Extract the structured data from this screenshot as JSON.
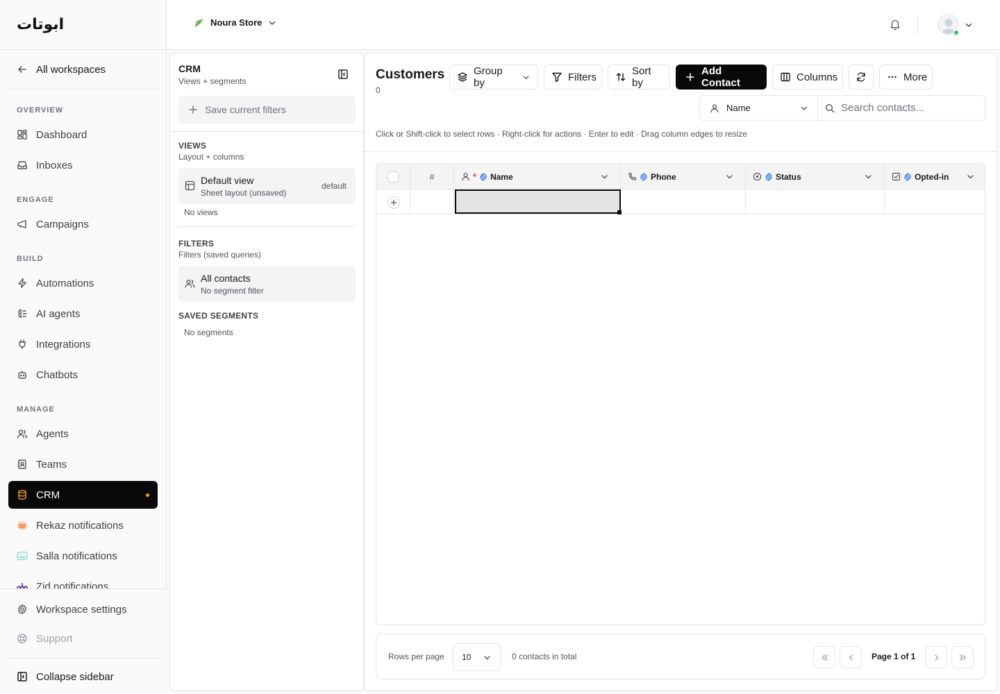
{
  "brand": {
    "logo_text": "ابوتات"
  },
  "topbar": {
    "store_name": "Noura Store"
  },
  "sidebar": {
    "back_label": "All workspaces",
    "sections": {
      "overview": "OVERVIEW",
      "engage": "ENGAGE",
      "build": "BUILD",
      "manage": "MANAGE"
    },
    "items": {
      "dashboard": "Dashboard",
      "inboxes": "Inboxes",
      "campaigns": "Campaigns",
      "automations": "Automations",
      "ai_agents": "AI agents",
      "integrations": "Integrations",
      "chatbots": "Chatbots",
      "agents": "Agents",
      "teams": "Teams",
      "crm": "CRM",
      "rekaz": "Rekaz notifications",
      "salla": "Salla notifications",
      "zid": "Zid notifications"
    },
    "workspace_settings": "Workspace settings",
    "support": "Support",
    "collapse": "Collapse sidebar",
    "active_item": "CRM",
    "accent_color": "#f59e0b"
  },
  "crm_panel": {
    "title": "CRM",
    "subtitle": "Views + segments",
    "save_filters": "Save current filters",
    "views": {
      "label": "VIEWS",
      "sub": "Layout + columns",
      "card_title": "Default view",
      "card_sub": "Sheet layout (unsaved)",
      "card_tag": "default",
      "empty": "No views"
    },
    "filters": {
      "label": "FILTERS",
      "sub": "Filters (saved queries)",
      "card_title": "All contacts",
      "card_sub": "No segment filter"
    },
    "segments": {
      "label": "SAVED SEGMENTS",
      "empty": "No segments"
    }
  },
  "main": {
    "title": "Customers",
    "count": "0",
    "toolbar": {
      "group_by": "Group by",
      "filters": "Filters",
      "sort_by": "Sort by",
      "add_contact": "Add Contact",
      "columns": "Columns",
      "more": "More"
    },
    "search": {
      "field": "Name",
      "placeholder": "Search contacts..."
    },
    "hint": "Click or Shift-click to select rows · Right-click for actions · Enter to edit · Drag column edges to resize",
    "grid": {
      "columns": [
        "#",
        "Name",
        "Phone",
        "Status",
        "Opted-in"
      ],
      "required_marker": "*",
      "rows": []
    },
    "pager": {
      "rows_per_page_label": "Rows per page",
      "rows_per_page": "10",
      "total": "0 contacts in total",
      "page_info": "Page 1 of 1"
    }
  }
}
